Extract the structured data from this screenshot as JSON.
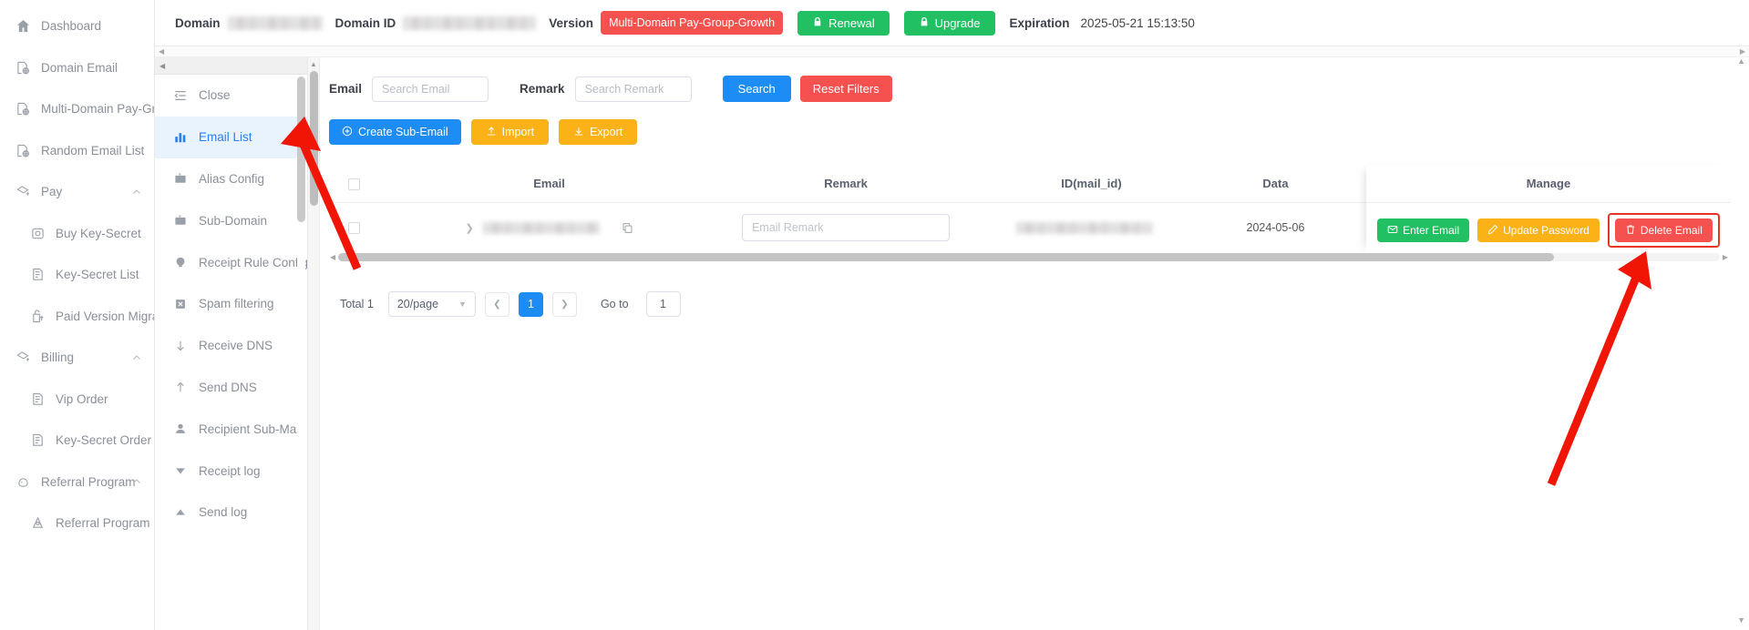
{
  "sidebar": {
    "items": [
      {
        "label": "Dashboard",
        "icon": "home-icon",
        "level": 0,
        "expandable": false
      },
      {
        "label": "Domain Email",
        "icon": "domain-email-icon",
        "level": 0,
        "expandable": false
      },
      {
        "label": "Multi-Domain Pay-Group",
        "icon": "domain-email-icon",
        "level": 0,
        "expandable": false
      },
      {
        "label": "Random Email List",
        "icon": "domain-email-icon",
        "level": 0,
        "expandable": false
      },
      {
        "label": "Pay",
        "icon": "pay-icon",
        "level": 0,
        "expandable": true
      },
      {
        "label": "Buy Key-Secret",
        "icon": "buy-icon",
        "level": 1,
        "expandable": false
      },
      {
        "label": "Key-Secret List",
        "icon": "list-icon",
        "level": 1,
        "expandable": false
      },
      {
        "label": "Paid Version Migration",
        "icon": "migration-icon",
        "level": 1,
        "expandable": false
      },
      {
        "label": "Billing",
        "icon": "pay-icon",
        "level": 0,
        "expandable": true
      },
      {
        "label": "Vip Order",
        "icon": "list-icon",
        "level": 1,
        "expandable": false
      },
      {
        "label": "Key-Secret Order",
        "icon": "list-icon",
        "level": 1,
        "expandable": false
      },
      {
        "label": "Referral Program",
        "icon": "referral-icon",
        "level": 0,
        "expandable": true
      },
      {
        "label": "Referral Program",
        "icon": "referral-sub-icon",
        "level": 1,
        "expandable": false
      }
    ]
  },
  "header": {
    "domain_label": "Domain",
    "domain_value_masked": true,
    "domain_id_label": "Domain ID",
    "domain_id_value_masked": true,
    "version_label": "Version",
    "version_tag": "Multi-Domain Pay-Group-Growth",
    "renewal_button": "Renewal",
    "upgrade_button": "Upgrade",
    "expiration_label": "Expiration",
    "expiration_value": "2025-05-21 15:13:50",
    "version_tag_color": "#f5514f",
    "renewal_color": "#21c063",
    "upgrade_color": "#21c063"
  },
  "inner_menu": {
    "items": [
      {
        "label": "Close",
        "icon": "collapse-menu-icon",
        "active": false
      },
      {
        "label": "Email List",
        "icon": "bar-chart-icon",
        "active": true
      },
      {
        "label": "Alias Config",
        "icon": "briefcase-icon",
        "active": false
      },
      {
        "label": "Sub-Domain",
        "icon": "briefcase-icon",
        "active": false
      },
      {
        "label": "Receipt Rule Config",
        "icon": "bulb-icon",
        "active": false
      },
      {
        "label": "Spam filtering",
        "icon": "spam-icon",
        "active": false
      },
      {
        "label": "Receive DNS",
        "icon": "arrow-down-icon",
        "active": false
      },
      {
        "label": "Send DNS",
        "icon": "arrow-up-icon",
        "active": false
      },
      {
        "label": "Recipient Sub-Mail",
        "icon": "user-icon",
        "active": false
      },
      {
        "label": "Receipt log",
        "icon": "triangle-down-icon",
        "active": false
      },
      {
        "label": "Send log",
        "icon": "triangle-up-icon",
        "active": false
      }
    ],
    "active_color": "#2a7ff0",
    "active_bg": "#e8f3fe"
  },
  "filters": {
    "email_label": "Email",
    "email_placeholder": "Search Email",
    "email_value": "",
    "remark_label": "Remark",
    "remark_placeholder": "Search Remark",
    "remark_value": "",
    "search_button": "Search",
    "reset_button": "Reset Filters"
  },
  "actions": {
    "create_button": "Create Sub-Email",
    "import_button": "Import",
    "export_button": "Export"
  },
  "table": {
    "columns": [
      "",
      "Email",
      "Remark",
      "ID(mail_id)",
      "Data",
      "Manage"
    ],
    "rows": [
      {
        "email_masked": true,
        "remark_placeholder": "Email Remark",
        "remark_value": "",
        "mail_id_masked": true,
        "date": "2024-05-06",
        "manage": {
          "enter_email": "Enter Email",
          "update_password": "Update Password",
          "delete_email": "Delete Email"
        }
      }
    ]
  },
  "pagination": {
    "total_label": "Total 1",
    "page_size": "20/page",
    "current_page": "1",
    "goto_label": "Go to",
    "goto_value": "1"
  }
}
